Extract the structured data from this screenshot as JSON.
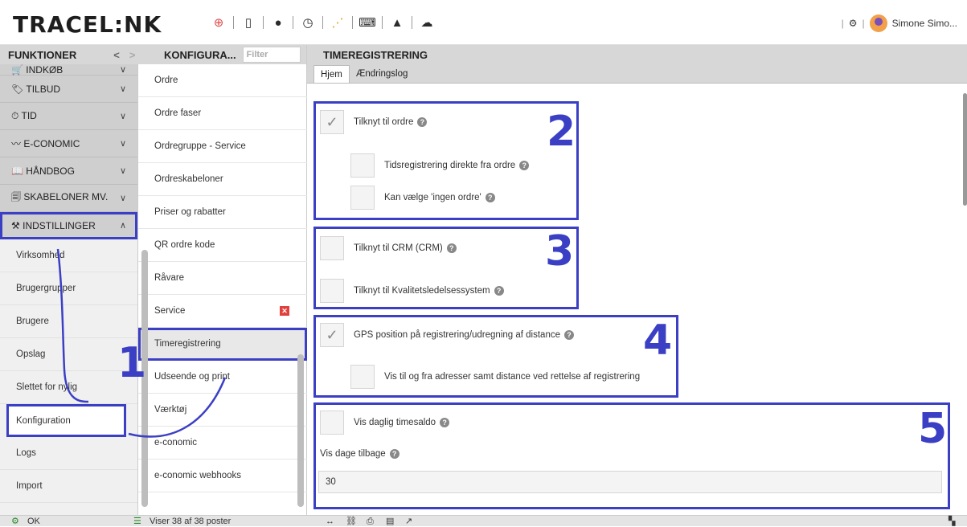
{
  "app": {
    "logo_text": "TRACEL:NK",
    "user_name": "Simone Simo..."
  },
  "toolbar_icons": [
    "lifebuoy-icon",
    "phone-icon",
    "chat-icon",
    "clock-icon",
    "flow-icon",
    "keyboard-icon",
    "warning-icon",
    "ai-cloud-icon"
  ],
  "funktioner": {
    "header": "FUNKTIONER",
    "groups": [
      {
        "label": "INDKØB",
        "icon": "🛒"
      },
      {
        "label": "TILBUD",
        "icon": "🏷"
      },
      {
        "label": "TID",
        "icon": "⏱"
      },
      {
        "label": "E-CONOMIC",
        "icon": "〰"
      },
      {
        "label": "HÅNDBOG",
        "icon": "📖"
      },
      {
        "label": "SKABELONER MV.",
        "icon": "🗐"
      },
      {
        "label": "INDSTILLINGER",
        "icon": "⚒"
      }
    ],
    "items": [
      "Virksomhed",
      "Brugergrupper",
      "Brugere",
      "Opslag",
      "Slettet for nylig",
      "Konfiguration",
      "Logs",
      "Import"
    ]
  },
  "konfig": {
    "header": "KONFIGURA...",
    "filter_placeholder": "Filter",
    "items": [
      "Ordre",
      "Ordre faser",
      "Ordregruppe - Service",
      "Ordreskabeloner",
      "Priser og rabatter",
      "QR ordre kode",
      "Råvare",
      "Service",
      "Timeregistrering",
      "Udseende og print",
      "Værktøj",
      "e-conomic",
      "e-conomic webhooks"
    ]
  },
  "main": {
    "header": "TIMEREGISTRERING",
    "tabs": [
      "Hjem",
      "Ændringslog"
    ],
    "settings": {
      "s1": "Tilknyt til ordre",
      "s2": "Tidsregistrering direkte fra ordre",
      "s3": "Kan vælge 'ingen ordre'",
      "s4": "Tilknyt til CRM (CRM)",
      "s5": "Tilknyt til Kvalitetsledelsessystem",
      "s6": "GPS position på registrering/udregning af distance",
      "s7": "Vis til og fra adresser samt distance ved rettelse af registrering",
      "s8": "Vis daglig timesaldo",
      "s9": "Vis dage tilbage",
      "s9_value": "30"
    },
    "annotations": [
      "1",
      "2",
      "3",
      "4",
      "5"
    ]
  },
  "status": {
    "ok": "OK",
    "count": "Viser 38 af 38 poster"
  },
  "colors": {
    "annotation": "#3b3fc4",
    "delete": "#e0413c"
  }
}
